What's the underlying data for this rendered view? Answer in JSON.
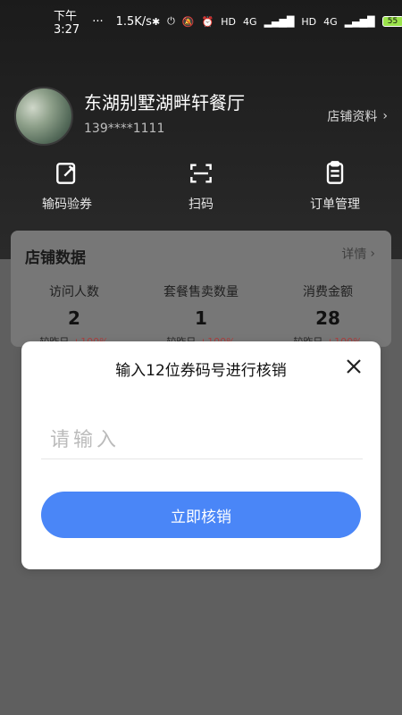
{
  "status_bar": {
    "time": "下午3:27",
    "dots": "···",
    "speed": "1.5K/s",
    "hd1": "HD",
    "net1": "4G",
    "hd2": "HD",
    "net2": "4G",
    "battery": "55"
  },
  "header": {
    "shop_name": "东湖别墅湖畔轩餐厅",
    "phone": "139****1111",
    "shop_link": "店铺资料"
  },
  "actions": [
    {
      "label": "输码验券",
      "icon": "edit-icon"
    },
    {
      "label": "扫码",
      "icon": "scan-icon"
    },
    {
      "label": "订单管理",
      "icon": "clipboard-icon"
    }
  ],
  "store_data": {
    "title": "店铺数据",
    "detail": "详情",
    "stats": [
      {
        "label": "访问人数",
        "value": "2",
        "compare": "较昨日",
        "change": "+100%"
      },
      {
        "label": "套餐售卖数量",
        "value": "1",
        "compare": "较昨日",
        "change": "+100%"
      },
      {
        "label": "消费金额",
        "value": "28",
        "compare": "较昨日",
        "change": "+100%"
      }
    ]
  },
  "modal": {
    "title": "输入12位券码号进行核销",
    "input_placeholder": "请输入",
    "input_value": "",
    "submit_label": "立即核销"
  }
}
